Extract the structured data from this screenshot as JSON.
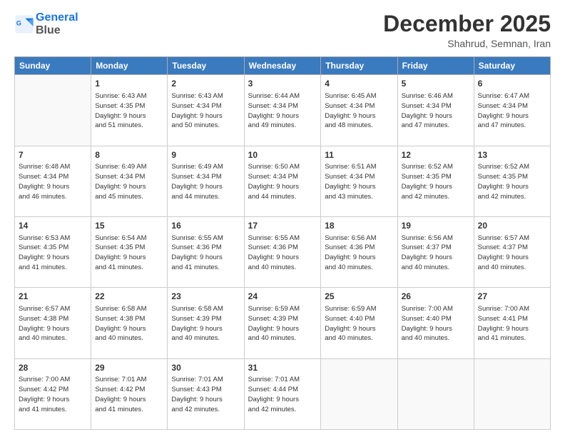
{
  "header": {
    "logo_line1": "General",
    "logo_line2": "Blue",
    "title": "December 2025",
    "subtitle": "Shahrud, Semnan, Iran"
  },
  "days_of_week": [
    "Sunday",
    "Monday",
    "Tuesday",
    "Wednesday",
    "Thursday",
    "Friday",
    "Saturday"
  ],
  "weeks": [
    [
      {
        "day": "",
        "info": ""
      },
      {
        "day": "1",
        "info": "Sunrise: 6:43 AM\nSunset: 4:35 PM\nDaylight: 9 hours\nand 51 minutes."
      },
      {
        "day": "2",
        "info": "Sunrise: 6:43 AM\nSunset: 4:34 PM\nDaylight: 9 hours\nand 50 minutes."
      },
      {
        "day": "3",
        "info": "Sunrise: 6:44 AM\nSunset: 4:34 PM\nDaylight: 9 hours\nand 49 minutes."
      },
      {
        "day": "4",
        "info": "Sunrise: 6:45 AM\nSunset: 4:34 PM\nDaylight: 9 hours\nand 48 minutes."
      },
      {
        "day": "5",
        "info": "Sunrise: 6:46 AM\nSunset: 4:34 PM\nDaylight: 9 hours\nand 47 minutes."
      },
      {
        "day": "6",
        "info": "Sunrise: 6:47 AM\nSunset: 4:34 PM\nDaylight: 9 hours\nand 47 minutes."
      }
    ],
    [
      {
        "day": "7",
        "info": "Sunrise: 6:48 AM\nSunset: 4:34 PM\nDaylight: 9 hours\nand 46 minutes."
      },
      {
        "day": "8",
        "info": "Sunrise: 6:49 AM\nSunset: 4:34 PM\nDaylight: 9 hours\nand 45 minutes."
      },
      {
        "day": "9",
        "info": "Sunrise: 6:49 AM\nSunset: 4:34 PM\nDaylight: 9 hours\nand 44 minutes."
      },
      {
        "day": "10",
        "info": "Sunrise: 6:50 AM\nSunset: 4:34 PM\nDaylight: 9 hours\nand 44 minutes."
      },
      {
        "day": "11",
        "info": "Sunrise: 6:51 AM\nSunset: 4:34 PM\nDaylight: 9 hours\nand 43 minutes."
      },
      {
        "day": "12",
        "info": "Sunrise: 6:52 AM\nSunset: 4:35 PM\nDaylight: 9 hours\nand 42 minutes."
      },
      {
        "day": "13",
        "info": "Sunrise: 6:52 AM\nSunset: 4:35 PM\nDaylight: 9 hours\nand 42 minutes."
      }
    ],
    [
      {
        "day": "14",
        "info": "Sunrise: 6:53 AM\nSunset: 4:35 PM\nDaylight: 9 hours\nand 41 minutes."
      },
      {
        "day": "15",
        "info": "Sunrise: 6:54 AM\nSunset: 4:35 PM\nDaylight: 9 hours\nand 41 minutes."
      },
      {
        "day": "16",
        "info": "Sunrise: 6:55 AM\nSunset: 4:36 PM\nDaylight: 9 hours\nand 41 minutes."
      },
      {
        "day": "17",
        "info": "Sunrise: 6:55 AM\nSunset: 4:36 PM\nDaylight: 9 hours\nand 40 minutes."
      },
      {
        "day": "18",
        "info": "Sunrise: 6:56 AM\nSunset: 4:36 PM\nDaylight: 9 hours\nand 40 minutes."
      },
      {
        "day": "19",
        "info": "Sunrise: 6:56 AM\nSunset: 4:37 PM\nDaylight: 9 hours\nand 40 minutes."
      },
      {
        "day": "20",
        "info": "Sunrise: 6:57 AM\nSunset: 4:37 PM\nDaylight: 9 hours\nand 40 minutes."
      }
    ],
    [
      {
        "day": "21",
        "info": "Sunrise: 6:57 AM\nSunset: 4:38 PM\nDaylight: 9 hours\nand 40 minutes."
      },
      {
        "day": "22",
        "info": "Sunrise: 6:58 AM\nSunset: 4:38 PM\nDaylight: 9 hours\nand 40 minutes."
      },
      {
        "day": "23",
        "info": "Sunrise: 6:58 AM\nSunset: 4:39 PM\nDaylight: 9 hours\nand 40 minutes."
      },
      {
        "day": "24",
        "info": "Sunrise: 6:59 AM\nSunset: 4:39 PM\nDaylight: 9 hours\nand 40 minutes."
      },
      {
        "day": "25",
        "info": "Sunrise: 6:59 AM\nSunset: 4:40 PM\nDaylight: 9 hours\nand 40 minutes."
      },
      {
        "day": "26",
        "info": "Sunrise: 7:00 AM\nSunset: 4:40 PM\nDaylight: 9 hours\nand 40 minutes."
      },
      {
        "day": "27",
        "info": "Sunrise: 7:00 AM\nSunset: 4:41 PM\nDaylight: 9 hours\nand 41 minutes."
      }
    ],
    [
      {
        "day": "28",
        "info": "Sunrise: 7:00 AM\nSunset: 4:42 PM\nDaylight: 9 hours\nand 41 minutes."
      },
      {
        "day": "29",
        "info": "Sunrise: 7:01 AM\nSunset: 4:42 PM\nDaylight: 9 hours\nand 41 minutes."
      },
      {
        "day": "30",
        "info": "Sunrise: 7:01 AM\nSunset: 4:43 PM\nDaylight: 9 hours\nand 42 minutes."
      },
      {
        "day": "31",
        "info": "Sunrise: 7:01 AM\nSunset: 4:44 PM\nDaylight: 9 hours\nand 42 minutes."
      },
      {
        "day": "",
        "info": ""
      },
      {
        "day": "",
        "info": ""
      },
      {
        "day": "",
        "info": ""
      }
    ]
  ]
}
